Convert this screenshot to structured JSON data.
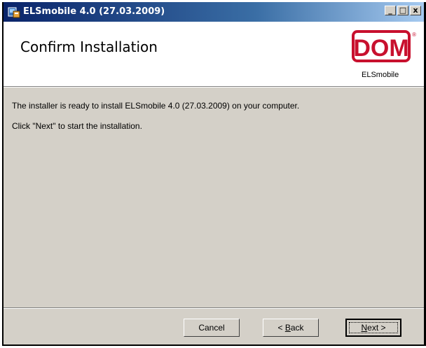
{
  "window": {
    "title": "ELSmobile 4.0 (27.03.2009)",
    "controls": {
      "minimize": "_",
      "maximize": "□",
      "close": "x"
    }
  },
  "header": {
    "title": "Confirm Installation",
    "logo": {
      "text": "DOM",
      "registered": "®",
      "subtitle": "ELSmobile",
      "color": "#c8102e"
    }
  },
  "content": {
    "line1": "The installer is ready to install ELSmobile 4.0 (27.03.2009) on your computer.",
    "line2": "Click \"Next\" to start the installation."
  },
  "buttons": {
    "cancel": "Cancel",
    "back_prefix": "< ",
    "back_accel": "B",
    "back_rest": "ack",
    "next_accel": "N",
    "next_rest": "ext >"
  },
  "colors": {
    "titlebar": "#0a246a",
    "dialog": "#d4d0c8",
    "accent": "#c8102e"
  }
}
